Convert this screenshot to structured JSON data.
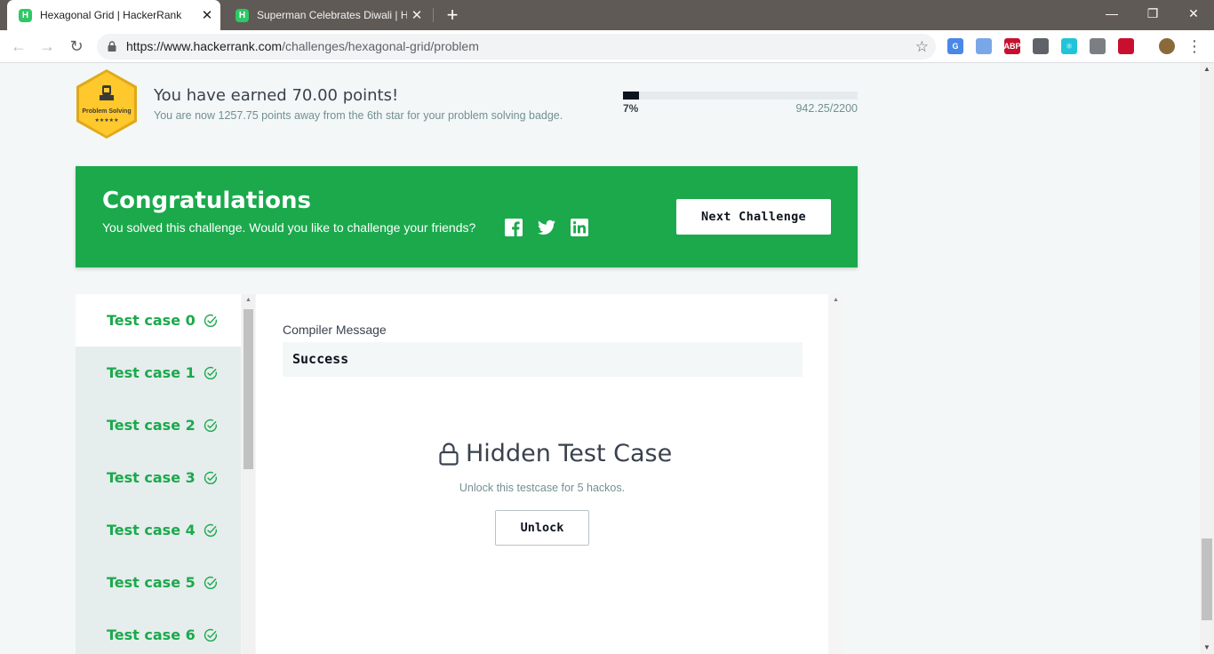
{
  "browser": {
    "tabs": [
      {
        "title": "Hexagonal Grid | HackerRank",
        "favicon": "H"
      },
      {
        "title": "Superman Celebrates Diwali | Ha",
        "favicon": "H"
      }
    ],
    "close_glyph": "✕",
    "new_tab_glyph": "+",
    "window_controls": {
      "minimize": "—",
      "restore": "❐",
      "close": "✕"
    },
    "url_host": "https://www.hackerrank.com",
    "url_path": "/challenges/hexagonal-grid/problem",
    "nav": {
      "back": "←",
      "forward": "→",
      "reload": "↻"
    },
    "star_glyph": "☆",
    "extensions": [
      {
        "name": "translate-extension-icon",
        "color": "#4a88e8",
        "glyph": "G"
      },
      {
        "name": "docs-extension-icon",
        "color": "#7aa7e8",
        "glyph": ""
      },
      {
        "name": "adblock-extension-icon",
        "color": "#c8102e",
        "glyph": "ABP"
      },
      {
        "name": "keep-extension-icon",
        "color": "#5f6368",
        "glyph": ""
      },
      {
        "name": "react-extension-icon",
        "color": "#20c4d8",
        "glyph": "⚛"
      },
      {
        "name": "chat-extension-icon",
        "color": "#7b7f83",
        "glyph": ""
      },
      {
        "name": "block-extension-icon",
        "color": "#c8102e",
        "glyph": ""
      },
      {
        "name": "profile-avatar-icon",
        "color": "#8a6a3a",
        "glyph": ""
      }
    ],
    "menu_glyph": "⋮"
  },
  "badge": {
    "label": "Problem Solving",
    "stars": "★★★★★",
    "color": "#ffc82c"
  },
  "earned": {
    "title": "You have earned 70.00 points!",
    "subtitle": "You are now 1257.75 points away from the 6th star for your problem solving badge.",
    "progress_fraction": 0.07,
    "progress_label": "7%",
    "progress_total": "942.25/2200"
  },
  "congrats": {
    "title": "Congratulations",
    "message": "You solved this challenge. Would you like to challenge your friends?",
    "next_button": "Next Challenge",
    "bg_color": "#1ba94c"
  },
  "test_cases": [
    {
      "label": "Test case 0",
      "active": true
    },
    {
      "label": "Test case 1",
      "active": false
    },
    {
      "label": "Test case 2",
      "active": false
    },
    {
      "label": "Test case 3",
      "active": false
    },
    {
      "label": "Test case 4",
      "active": false
    },
    {
      "label": "Test case 5",
      "active": false
    },
    {
      "label": "Test case 6",
      "active": false
    }
  ],
  "detail": {
    "compiler_label": "Compiler Message",
    "compiler_value": "Success",
    "hidden_title": "Hidden Test Case",
    "unlock_text": "Unlock this testcase for 5 hackos.",
    "unlock_button": "Unlock"
  }
}
